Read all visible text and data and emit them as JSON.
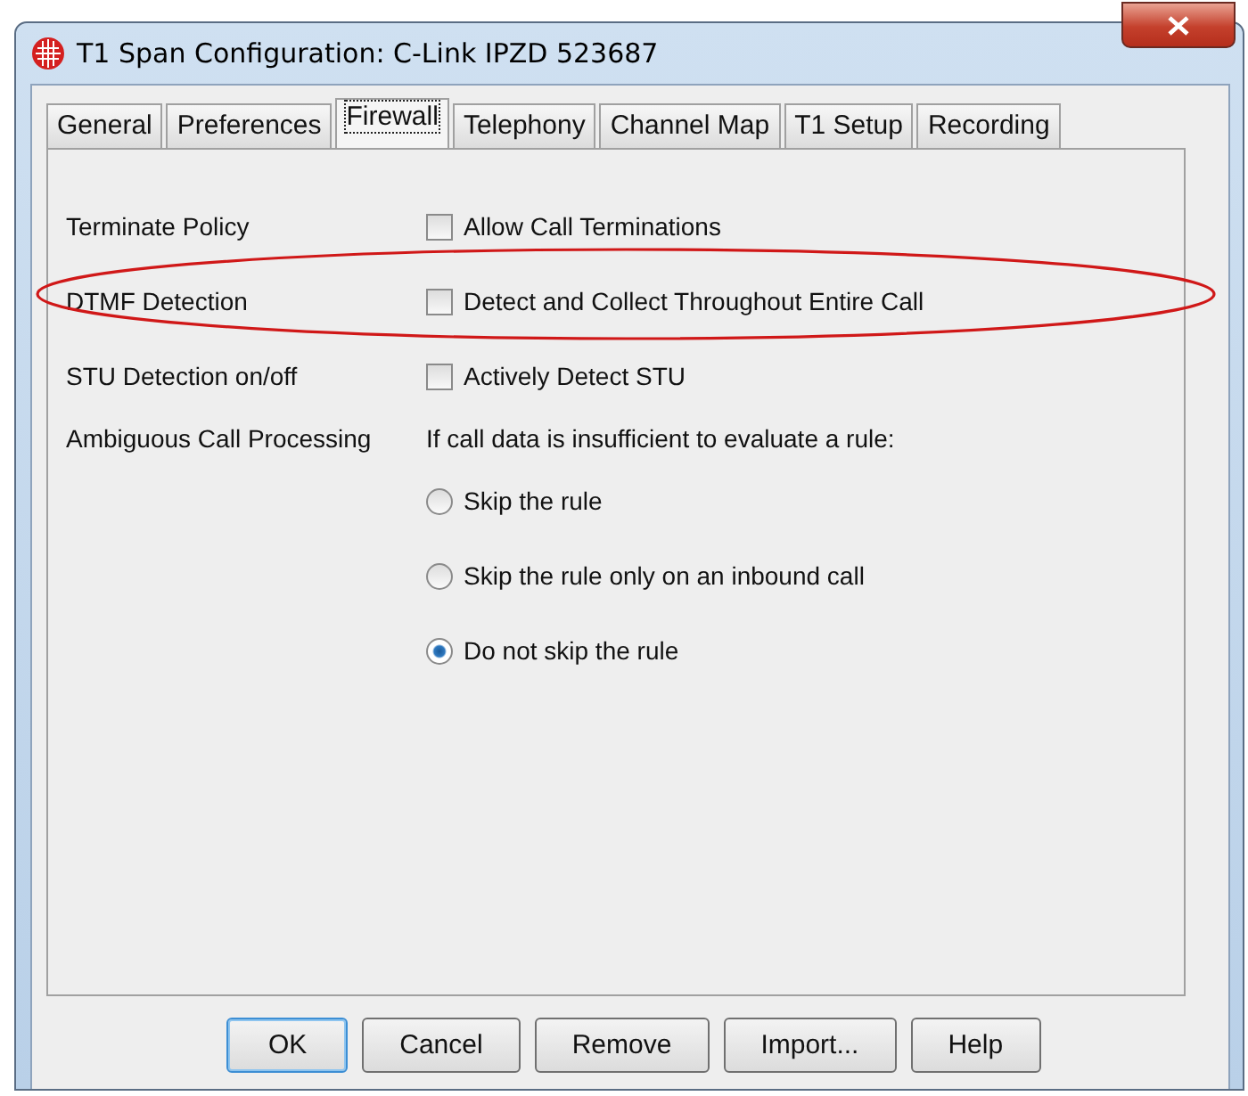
{
  "window": {
    "title": "T1 Span Configuration: C-Link IPZD 523687"
  },
  "tabs": [
    {
      "label": "General",
      "selected": false
    },
    {
      "label": "Preferences",
      "selected": false
    },
    {
      "label": "Firewall",
      "selected": true
    },
    {
      "label": "Telephony",
      "selected": false
    },
    {
      "label": "Channel Map",
      "selected": false
    },
    {
      "label": "T1 Setup",
      "selected": false
    },
    {
      "label": "Recording",
      "selected": false
    }
  ],
  "settings": [
    {
      "label": "Terminate Policy",
      "option": "Allow Call Terminations",
      "checked": false
    },
    {
      "label": "DTMF Detection",
      "option": "Detect and Collect Throughout Entire Call",
      "checked": false
    },
    {
      "label": "STU Detection on/off",
      "option": "Actively Detect STU",
      "checked": false
    }
  ],
  "ambiguous": {
    "label": "Ambiguous Call Processing",
    "prompt": "If call data is insufficient to evaluate a rule:",
    "options": [
      {
        "label": "Skip the rule",
        "selected": false
      },
      {
        "label": "Skip the rule only on an inbound call",
        "selected": false
      },
      {
        "label": "Do not skip the rule",
        "selected": true
      }
    ]
  },
  "buttons": [
    {
      "label": "OK",
      "default": true
    },
    {
      "label": "Cancel",
      "default": false
    },
    {
      "label": "Remove",
      "default": false
    },
    {
      "label": "Import...",
      "default": false
    },
    {
      "label": "Help",
      "default": false
    }
  ]
}
